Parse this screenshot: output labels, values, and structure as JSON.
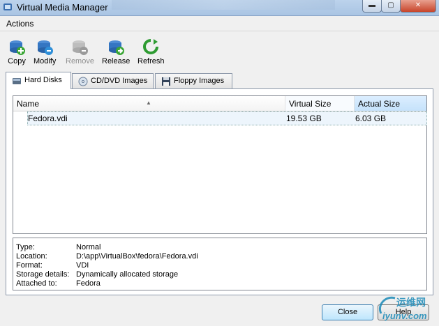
{
  "window": {
    "title": "Virtual Media Manager",
    "min_icon": "minimize-icon",
    "max_icon": "maximize-icon",
    "close_icon": "close-icon"
  },
  "menu": {
    "actions": "Actions"
  },
  "toolbar": {
    "copy": "Copy",
    "modify": "Modify",
    "remove": "Remove",
    "release": "Release",
    "refresh": "Refresh"
  },
  "tabs": {
    "hard_disks": "Hard Disks",
    "cd_dvd": "CD/DVD Images",
    "floppy": "Floppy Images"
  },
  "table": {
    "headers": {
      "name": "Name",
      "virtual_size": "Virtual Size",
      "actual_size": "Actual Size"
    },
    "rows": [
      {
        "name": "Fedora.vdi",
        "virtual_size": "19.53 GB",
        "actual_size": "6.03 GB"
      }
    ]
  },
  "details": {
    "type": {
      "label": "Type:",
      "value": "Normal"
    },
    "location": {
      "label": "Location:",
      "value": "D:\\app\\VirtualBox\\fedora\\Fedora.vdi"
    },
    "format": {
      "label": "Format:",
      "value": "VDI"
    },
    "storage": {
      "label": "Storage details:",
      "value": "Dynamically allocated storage"
    },
    "attached": {
      "label": "Attached to:",
      "value": "Fedora"
    }
  },
  "buttons": {
    "close": "Close",
    "help": "Help"
  },
  "watermark": {
    "top": "运维网",
    "bottom": "iyunv.com"
  },
  "colors": {
    "accent": "#3c7fb1",
    "selection": "#edf5fc",
    "titlebar": "#bcd3ec"
  }
}
